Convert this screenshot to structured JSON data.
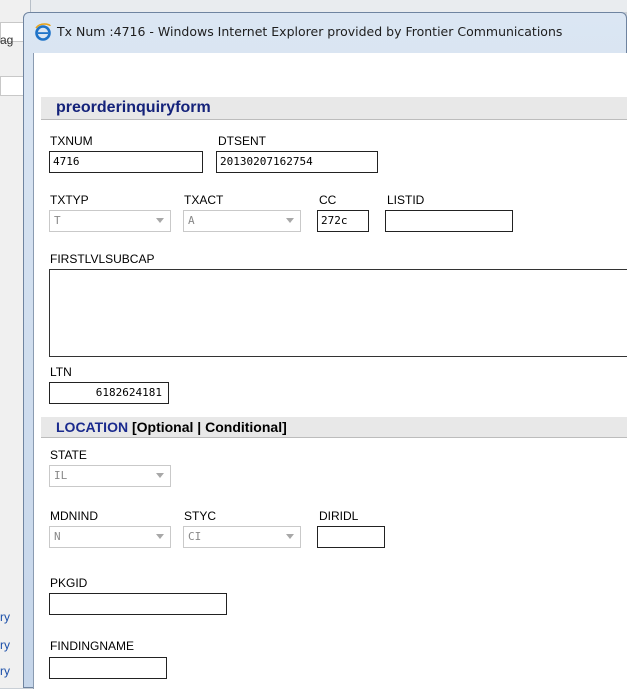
{
  "window": {
    "title": "Tx Num :4716 - Windows Internet Explorer provided by Frontier Communications"
  },
  "background": {
    "fragments": [
      "ag",
      "ry",
      "ry",
      "ry"
    ]
  },
  "form": {
    "title": "preorderinquiryform",
    "fields": {
      "txnum": {
        "label": "TXNUM",
        "value": "4716"
      },
      "dtsent": {
        "label": "DTSENT",
        "value": "20130207162754"
      },
      "txtyp": {
        "label": "TXTYP",
        "value": "T"
      },
      "txact": {
        "label": "TXACT",
        "value": "A"
      },
      "cc": {
        "label": "CC",
        "value": "272c"
      },
      "listid": {
        "label": "LISTID",
        "value": ""
      },
      "firstlvlsubcap": {
        "label": "FIRSTLVLSUBCAP",
        "value": ""
      },
      "ltn": {
        "label": "LTN",
        "value": "6182624181"
      }
    }
  },
  "location": {
    "title": "LOCATION",
    "subtitle": "[Optional | Conditional]",
    "fields": {
      "state": {
        "label": "STATE",
        "value": "IL"
      },
      "mdnind": {
        "label": "MDNIND",
        "value": "N"
      },
      "styc": {
        "label": "STYC",
        "value": "CI"
      },
      "diridl": {
        "label": "DIRIDL",
        "value": ""
      },
      "pkgid": {
        "label": "PKGID",
        "value": ""
      },
      "findingname": {
        "label": "FINDINGNAME",
        "value": ""
      }
    }
  }
}
